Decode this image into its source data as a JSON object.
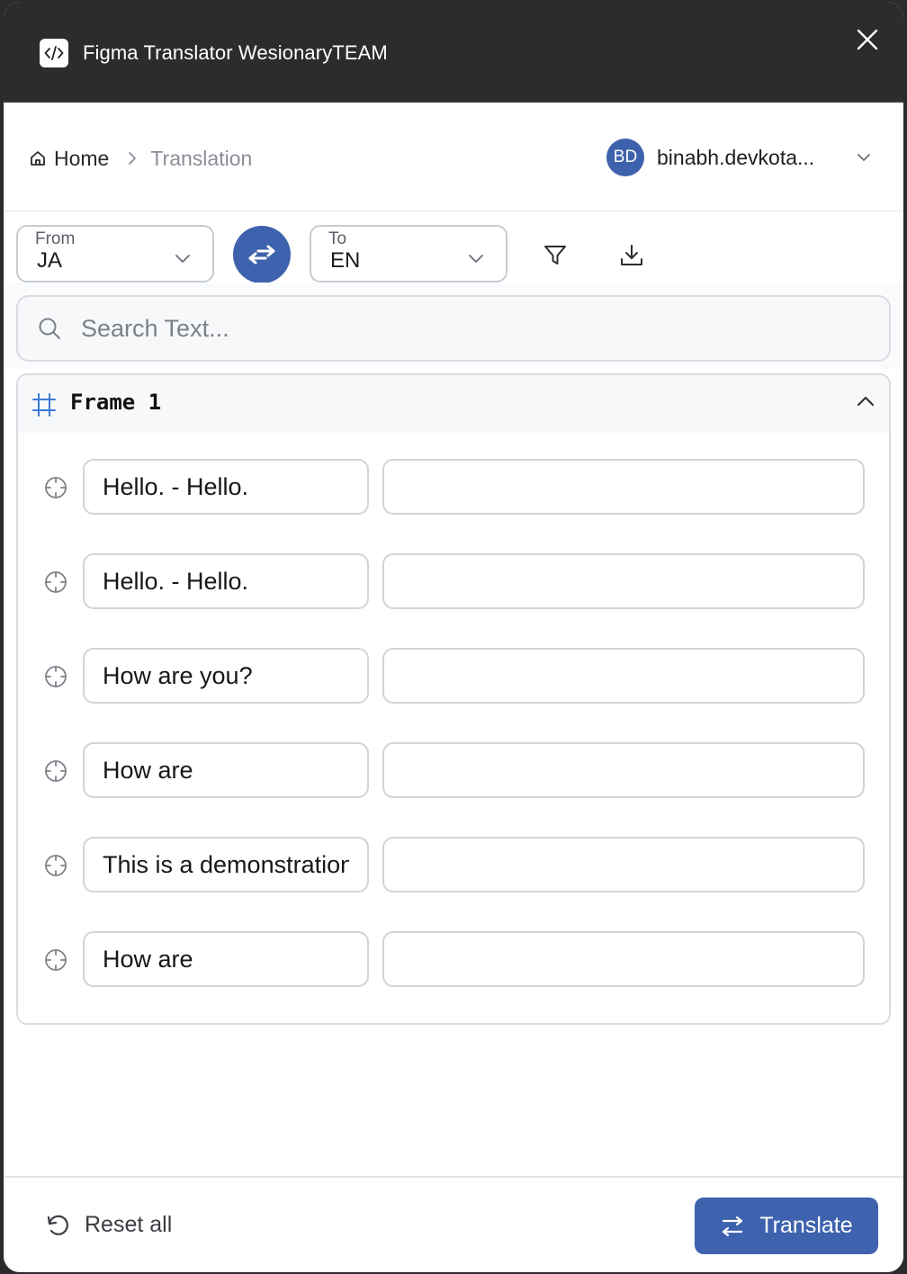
{
  "window": {
    "title": "Figma Translator WesionaryTEAM",
    "app_icon": "code-brackets-icon",
    "close_icon": "close-icon"
  },
  "breadcrumb": {
    "home_label": "Home",
    "current_label": "Translation"
  },
  "user": {
    "initials": "BD",
    "name": "binabh.devkota...",
    "avatar_color": "#3e62ad"
  },
  "languages": {
    "from_label": "From",
    "from_value": "JA",
    "to_label": "To",
    "to_value": "EN"
  },
  "search": {
    "placeholder": "Search Text...",
    "value": ""
  },
  "frame": {
    "title": "Frame 1",
    "rows": [
      {
        "source": "Hello. - Hello.",
        "translation": ""
      },
      {
        "source": "Hello. - Hello.",
        "translation": ""
      },
      {
        "source": "How are you?",
        "translation": ""
      },
      {
        "source": "How are",
        "translation": ""
      },
      {
        "source": "This is a demonstration",
        "translation": ""
      },
      {
        "source": "How are",
        "translation": ""
      }
    ]
  },
  "footer": {
    "reset_label": "Reset all",
    "translate_label": "Translate"
  },
  "colors": {
    "accent": "#3e62ad",
    "titlebar": "#2c2c2c",
    "frame_icon": "#3a7bd5"
  }
}
